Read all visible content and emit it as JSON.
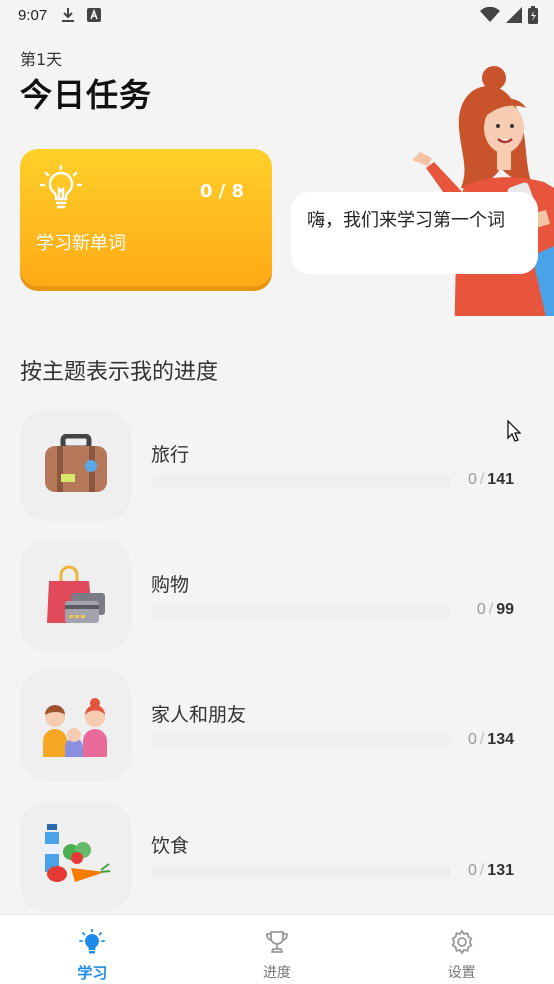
{
  "status_bar": {
    "time": "9:07",
    "icons": [
      "download-icon",
      "a-badge-icon",
      "wifi-icon",
      "signal-icon",
      "battery-icon"
    ]
  },
  "header": {
    "day_label": "第1天",
    "title": "今日任务"
  },
  "new_words_card": {
    "progress": "0 / 8",
    "label": "学习新单词",
    "icon": "lightbulb-icon",
    "gradient": [
      "#ffd02a",
      "#ffaa16"
    ]
  },
  "speech_bubble": {
    "text": "嗨，我们来学习第一个词"
  },
  "progress_section": {
    "title": "按主题表示我的进度",
    "topics": [
      {
        "name": "旅行",
        "done": "0",
        "separator": "/",
        "total": "141",
        "icon": "suitcase-icon",
        "progress": 0
      },
      {
        "name": "购物",
        "done": "0",
        "separator": "/",
        "total": "99",
        "icon": "shopping-bag-icon",
        "progress": 0
      },
      {
        "name": "家人和朋友",
        "done": "0",
        "separator": "/",
        "total": "134",
        "icon": "family-icon",
        "progress": 0
      },
      {
        "name": "饮食",
        "done": "0",
        "separator": "/",
        "total": "131",
        "icon": "food-icon",
        "progress": 0
      }
    ]
  },
  "bottom_nav": {
    "items": [
      {
        "label": "学习",
        "icon": "lightbulb-icon",
        "active": true
      },
      {
        "label": "进度",
        "icon": "trophy-icon",
        "active": false
      },
      {
        "label": "设置",
        "icon": "gear-icon",
        "active": false
      }
    ],
    "accent": "#1f8be8"
  }
}
